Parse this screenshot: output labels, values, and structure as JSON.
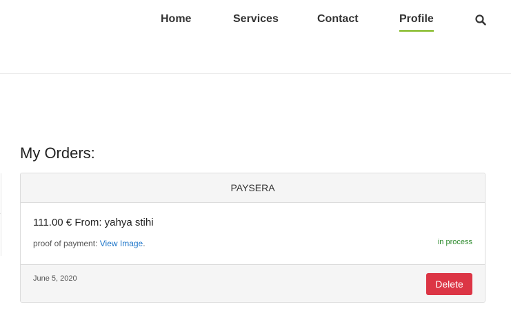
{
  "nav": {
    "home": "Home",
    "services": "Services",
    "contact": "Contact",
    "profile": "Profile",
    "active": "profile",
    "search_icon": "search-icon",
    "accent_color": "#7cb518"
  },
  "page": {
    "title": "My Orders:"
  },
  "order": {
    "payment_method": "PAYSERA",
    "amount_line": "111.00 € From: yahya stihi",
    "proof_label": "proof of payment: ",
    "proof_link": "View Image",
    "proof_suffix": ".",
    "status": "in process",
    "status_color": "#2e8b2e",
    "date": "June 5, 2020",
    "delete_label": "Delete",
    "delete_color": "#dc3545"
  }
}
